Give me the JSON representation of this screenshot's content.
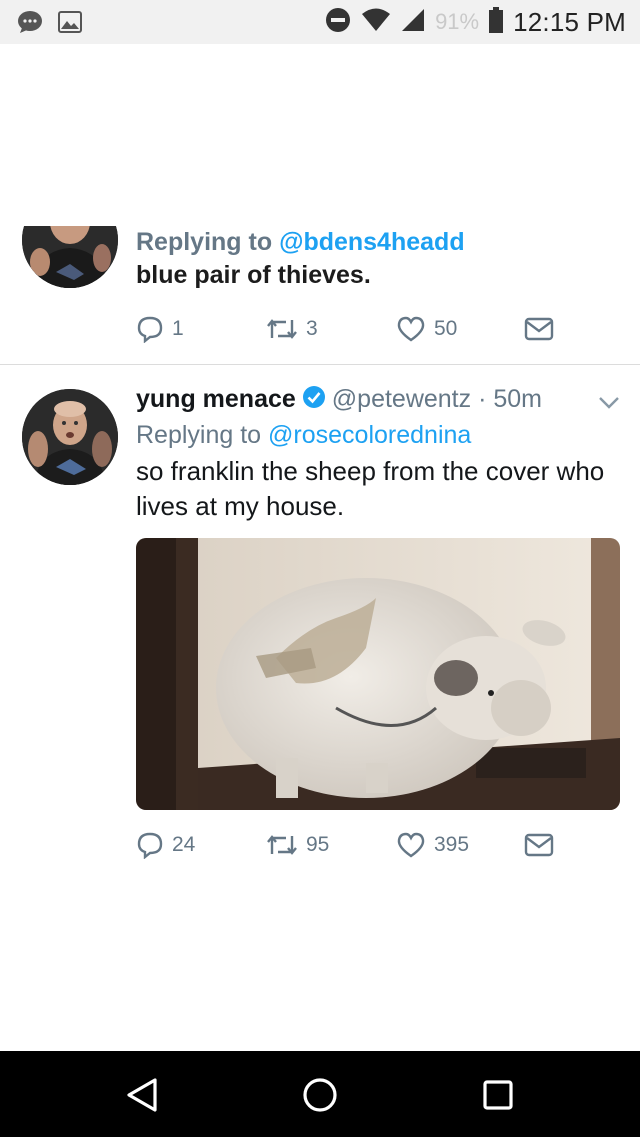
{
  "status_bar": {
    "battery": "91%",
    "time": "12:15 PM",
    "icons": [
      "chat-notification-icon",
      "image-notification-icon",
      "do-not-disturb-icon",
      "wifi-icon",
      "signal-icon",
      "battery-icon"
    ]
  },
  "tweet1": {
    "reply_prefix": "Replying to ",
    "reply_handle": "@bdens4headd",
    "text": "blue pair of thieves.",
    "replies": "1",
    "retweets": "3",
    "likes": "50"
  },
  "tweet2": {
    "display_name": "yung menace",
    "handle_time": "@petewentz · 50m",
    "reply_prefix": "Replying to ",
    "reply_handle": "@rosecolorednina",
    "text": "so franklin the sheep from the cover who lives at my house.",
    "replies": "24",
    "retweets": "95",
    "likes": "395"
  },
  "colors": {
    "accent": "#1da1f2",
    "muted": "#657786",
    "nav_bar": "#000000"
  },
  "nav": [
    "back-icon",
    "home-icon",
    "recents-icon"
  ]
}
